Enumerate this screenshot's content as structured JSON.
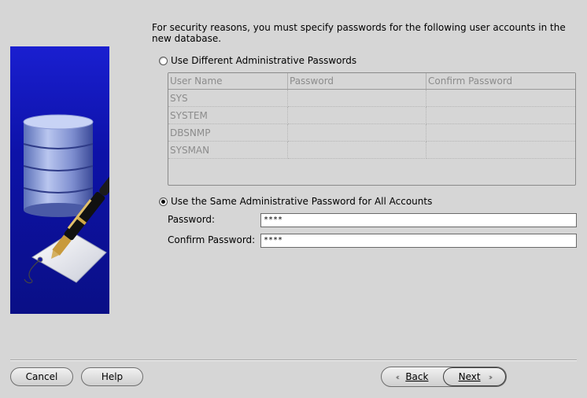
{
  "intro_text": "For security reasons, you must specify passwords for the following user accounts in the new database.",
  "option_different": {
    "label": "Use Different Administrative Passwords",
    "selected": false
  },
  "accounts_table": {
    "columns": [
      "User Name",
      "Password",
      "Confirm Password"
    ],
    "rows": [
      {
        "user": "SYS",
        "password": "",
        "confirm": ""
      },
      {
        "user": "SYSTEM",
        "password": "",
        "confirm": ""
      },
      {
        "user": "DBSNMP",
        "password": "",
        "confirm": ""
      },
      {
        "user": "SYSMAN",
        "password": "",
        "confirm": ""
      }
    ]
  },
  "option_same": {
    "label": "Use the Same Administrative Password for All Accounts",
    "selected": true
  },
  "password_field": {
    "label": "Password:",
    "value": "****"
  },
  "confirm_field": {
    "label": "Confirm Password:",
    "value": "****"
  },
  "buttons": {
    "cancel": "Cancel",
    "help": "Help",
    "back": "Back",
    "next": "Next"
  },
  "colors": {
    "background": "#d6d6d6",
    "illustration_blue": "#0d12a8"
  }
}
